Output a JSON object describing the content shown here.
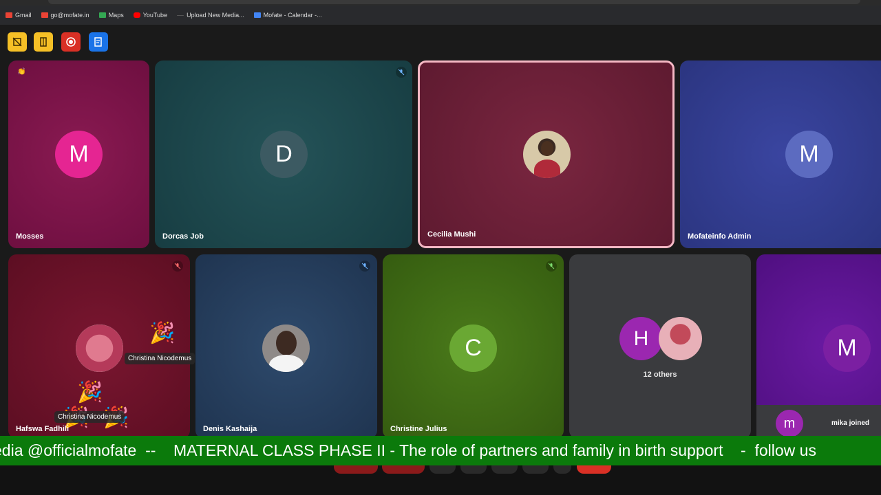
{
  "bookmarks": [
    {
      "label": "Gmail",
      "icon": "gmail-icon",
      "color": "#ea4335"
    },
    {
      "label": "go@mofate.in",
      "icon": "gmail-icon",
      "color": "#ea4335"
    },
    {
      "label": "Maps",
      "icon": "maps-icon",
      "color": "#34a853"
    },
    {
      "label": "YouTube",
      "icon": "youtube-icon",
      "color": "#ff0000"
    },
    {
      "label": "Upload New Media...",
      "icon": "upload-icon",
      "color": "#555555"
    },
    {
      "label": "Mofate - Calendar -...",
      "icon": "calendar-icon",
      "color": "#4285f4"
    }
  ],
  "toolbar": [
    {
      "icon": "hand-off-icon",
      "color": "#f6c026"
    },
    {
      "icon": "door-icon",
      "color": "#f6c026"
    },
    {
      "icon": "record-icon",
      "color": "#d93025"
    },
    {
      "icon": "notes-icon",
      "color": "#1a73e8"
    }
  ],
  "participants": [
    {
      "name": "Mosses",
      "initial": "M",
      "avatar_color": "#e52592",
      "bg": "#7a1145",
      "reaction": "👏"
    },
    {
      "name": "Dorcas Job",
      "initial": "D",
      "avatar_color": "#3c5a62",
      "bg": "#1e4a4f",
      "muted": true
    },
    {
      "name": "Cecilia Mushi",
      "bg": "#6b1f35",
      "active_speaker": true,
      "active_color": "#f5b8c4"
    },
    {
      "name": "Mofateinfo Admin",
      "initial": "M",
      "avatar_color": "#5c6bc0",
      "bg": "#2e3a8c"
    },
    {
      "name": "Hafswa Fadhili",
      "bg": "#6e1228",
      "muted": true
    },
    {
      "name": "Denis Kashaija",
      "bg": "#253a55",
      "muted": true
    },
    {
      "name": "Christine Julius",
      "initial": "C",
      "avatar_color": "#6aa833",
      "bg": "#3f6b14",
      "muted": true
    },
    {
      "others_label": "12 others",
      "initial": "H",
      "avatar_color": "#9b27b0",
      "bg": "#3a3b3e"
    },
    {
      "initial": "M",
      "avatar_color": "#7b1fa2",
      "bg": "#5c1591"
    }
  ],
  "floating_labels": [
    "Christina Nicodemus",
    "Christina Nicodemus"
  ],
  "join_toast": {
    "initial": "m",
    "avatar_color": "#9b27b0",
    "text": "mika joined"
  },
  "ticker": {
    "text": "edia @officialmofate  --    MATERNAL CLASS PHASE II - The role of partners and family in birth support    -  follow us",
    "bg": "#0b7a0b"
  }
}
